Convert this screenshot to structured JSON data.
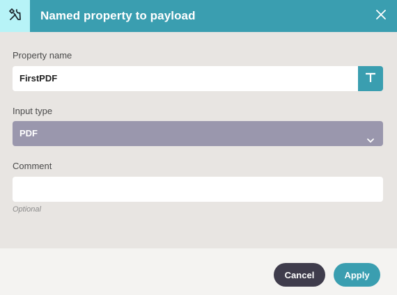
{
  "header": {
    "title": "Named property to payload",
    "icon": "tools-icon",
    "close_icon": "close-icon"
  },
  "property_name": {
    "label": "Property name",
    "value": "FirstPDF",
    "type_button_label": "T"
  },
  "input_type": {
    "label": "Input type",
    "selected": "PDF"
  },
  "comment": {
    "label": "Comment",
    "value": "",
    "hint": "Optional"
  },
  "footer": {
    "cancel_label": "Cancel",
    "apply_label": "Apply"
  },
  "colors": {
    "accent": "#3a9eb0",
    "header_icon_bg": "#b7f3f7",
    "select_bg": "#9a97ad",
    "cancel_bg": "#3f3c4c",
    "body_bg": "#e8e5e2",
    "footer_bg": "#f4f3f1"
  }
}
